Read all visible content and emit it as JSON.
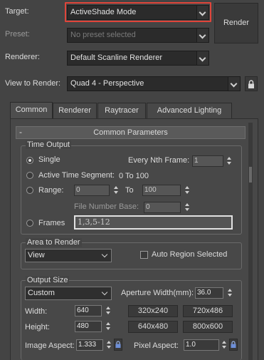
{
  "top": {
    "target_label": "Target:",
    "target_value": "ActiveShade Mode",
    "preset_label": "Preset:",
    "preset_placeholder": "No preset selected",
    "renderer_label": "Renderer:",
    "renderer_value": "Default Scanline Renderer",
    "view_label": "View to Render:",
    "view_value": "Quad 4 - Perspective",
    "render_button": "Render"
  },
  "tabs": [
    "Common",
    "Renderer",
    "Raytracer",
    "Advanced Lighting"
  ],
  "panel": {
    "collapse": "-",
    "title": "Common Parameters"
  },
  "time_output": {
    "title": "Time Output",
    "single": "Single",
    "every_nth_label": "Every Nth Frame:",
    "every_nth_value": "1",
    "active_segment": "Active Time Segment:",
    "active_range": "0 To 100",
    "range": "Range:",
    "range_from": "0",
    "range_to_label": "To",
    "range_to": "100",
    "file_number_base_label": "File Number Base:",
    "file_number_base": "0",
    "frames": "Frames",
    "frames_value": "1,3,5-12"
  },
  "area": {
    "title": "Area to Render",
    "value": "View",
    "auto_region": "Auto Region Selected"
  },
  "output_size": {
    "title": "Output Size",
    "preset": "Custom",
    "aperture_label": "Aperture Width(mm):",
    "aperture_value": "36.0",
    "width_label": "Width:",
    "width_value": "640",
    "height_label": "Height:",
    "height_value": "480",
    "presets": [
      "320x240",
      "720x486",
      "640x480",
      "800x600"
    ],
    "image_aspect_label": "Image Aspect:",
    "image_aspect_value": "1.333",
    "pixel_aspect_label": "Pixel Aspect:",
    "pixel_aspect_value": "1.0"
  },
  "colors": {
    "highlight": "#e0453a",
    "background": "#444444"
  }
}
